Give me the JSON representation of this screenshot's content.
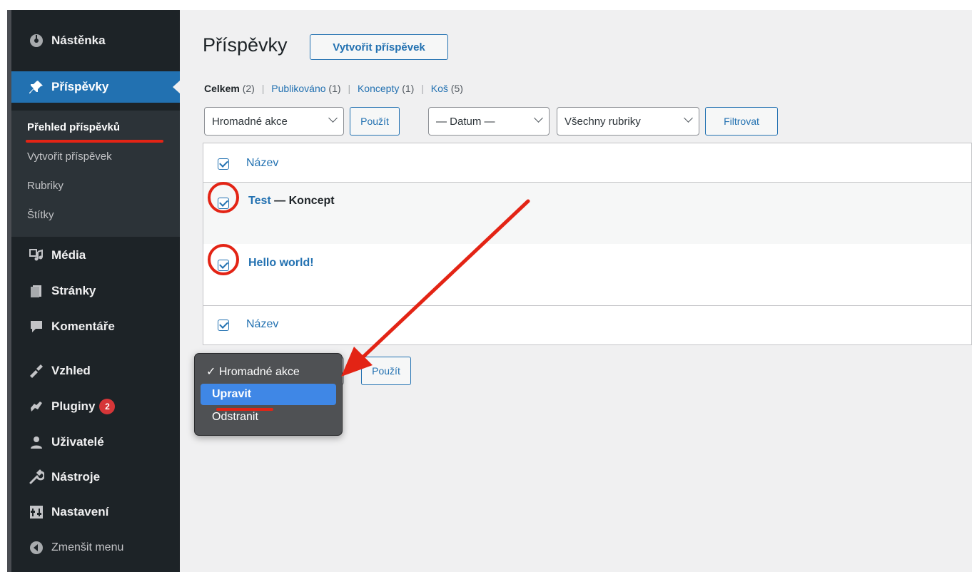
{
  "sidebar": {
    "items": [
      {
        "label": "Nástěnka",
        "icon": "dashboard-icon"
      },
      {
        "label": "Příspěvky",
        "icon": "pin-icon"
      },
      {
        "label": "Média",
        "icon": "media-icon"
      },
      {
        "label": "Stránky",
        "icon": "pages-icon"
      },
      {
        "label": "Komentáře",
        "icon": "comments-icon"
      },
      {
        "label": "Vzhled",
        "icon": "appearance-icon"
      },
      {
        "label": "Pluginy",
        "icon": "plugins-icon",
        "badge": "2"
      },
      {
        "label": "Uživatelé",
        "icon": "users-icon"
      },
      {
        "label": "Nástroje",
        "icon": "tools-icon"
      },
      {
        "label": "Nastavení",
        "icon": "settings-icon"
      },
      {
        "label": "Zmenšit menu",
        "icon": "collapse-icon"
      }
    ],
    "submenu": [
      "Přehled příspěvků",
      "Vytvořit příspěvek",
      "Rubriky",
      "Štítky"
    ]
  },
  "main": {
    "title": "Příspěvky",
    "new_post_label": "Vytvořit příspěvek",
    "filters": {
      "all_label": "Celkem",
      "all_count": "(2)",
      "published_label": "Publikováno",
      "published_count": "(1)",
      "drafts_label": "Koncepty",
      "drafts_count": "(1)",
      "trash_label": "Koš",
      "trash_count": "(5)"
    },
    "bulk_select": "Hromadné akce",
    "apply_label": "Použít",
    "date_select": "— Datum —",
    "category_select": "Všechny rubriky",
    "filter_label": "Filtrovat",
    "table": {
      "column_title": "Název",
      "rows": [
        {
          "title": "Test",
          "state": " — Koncept",
          "checked": true
        },
        {
          "title": "Hello world!",
          "state": "",
          "checked": true
        }
      ]
    },
    "bottom_apply_label": "Použít",
    "dropdown_options": [
      "✓ Hromadné akce",
      "Upravit",
      "Odstranit"
    ]
  },
  "colors": {
    "sidebar_bg": "#1d2327",
    "accent": "#2271b1",
    "annotation_red": "#e32415",
    "dropdown_highlight": "#3f87e6"
  }
}
